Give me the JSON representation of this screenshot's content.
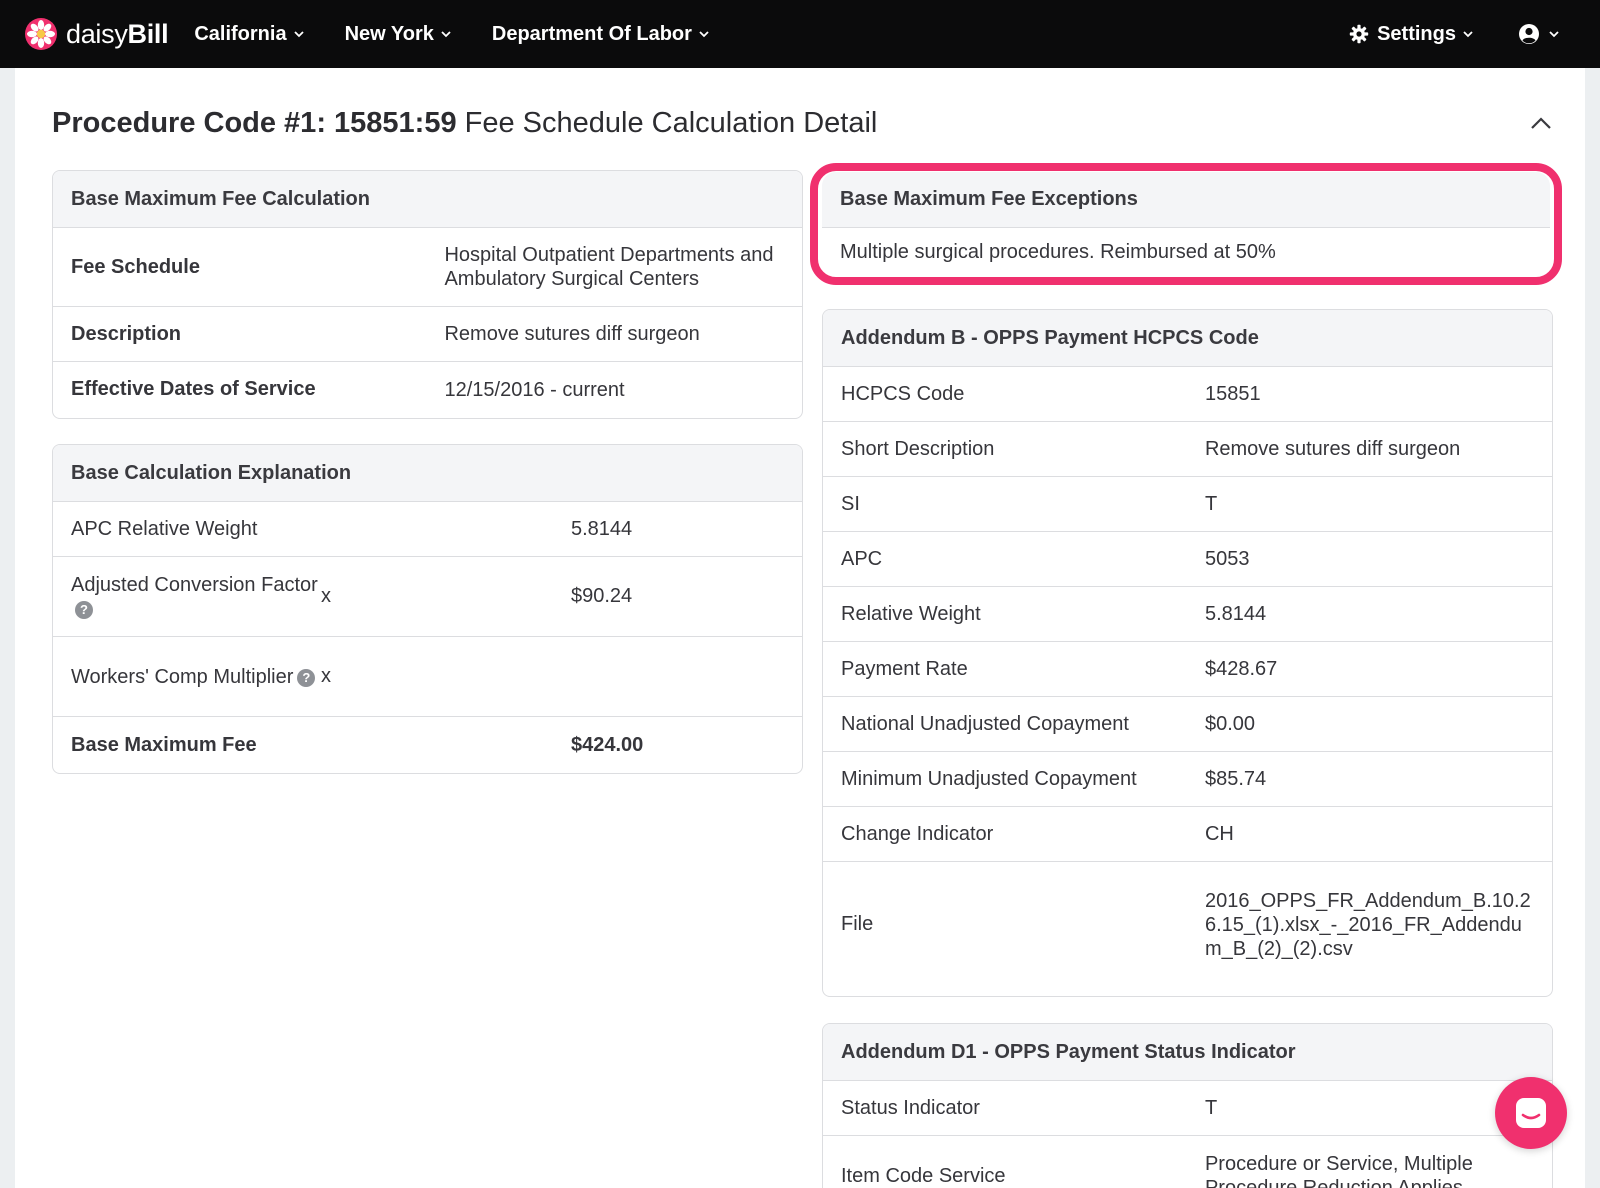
{
  "nav": {
    "logo_light": "daisy",
    "logo_bold": "Bill",
    "items": [
      "California",
      "New York",
      "Department Of Labor"
    ],
    "settings_label": "Settings"
  },
  "page": {
    "title_bold": "Procedure Code #1: 15851:59",
    "title_rest": " Fee Schedule Calculation Detail"
  },
  "base_max_fee": {
    "heading": "Base Maximum Fee Calculation",
    "rows": [
      {
        "label": "Fee Schedule",
        "value": "Hospital Outpatient Departments and Ambulatory Surgical Centers"
      },
      {
        "label": "Description",
        "value": "Remove sutures diff surgeon"
      },
      {
        "label": "Effective Dates of Service",
        "value": "12/15/2016 - current"
      }
    ]
  },
  "base_calc": {
    "heading": "Base Calculation Explanation",
    "rows": [
      {
        "label": "APC Relative Weight",
        "op": "",
        "value": "5.8144"
      },
      {
        "label": "Adjusted Conversion Factor",
        "op": "x",
        "value": "$90.24"
      },
      {
        "label": "Workers' Comp Multiplier",
        "op": "x",
        "value": ""
      },
      {
        "label": "Base Maximum Fee",
        "op": "",
        "value": "$424.00"
      }
    ]
  },
  "exceptions": {
    "heading": "Base Maximum Fee Exceptions",
    "text": "Multiple surgical procedures. Reimbursed at 50%"
  },
  "addendum_b": {
    "heading": "Addendum B - OPPS Payment HCPCS Code",
    "rows": [
      {
        "label": "HCPCS Code",
        "value": "15851"
      },
      {
        "label": "Short Description",
        "value": "Remove sutures diff surgeon"
      },
      {
        "label": "SI",
        "value": "T"
      },
      {
        "label": "APC",
        "value": "5053"
      },
      {
        "label": "Relative Weight",
        "value": "5.8144"
      },
      {
        "label": "Payment Rate",
        "value": "$428.67"
      },
      {
        "label": "National Unadjusted Copayment",
        "value": "$0.00"
      },
      {
        "label": "Minimum Unadjusted Copayment",
        "value": "$85.74"
      },
      {
        "label": "Change Indicator",
        "value": "CH"
      },
      {
        "label": "File",
        "value": "2016_OPPS_FR_Addendum_B.10.26.15_(1).xlsx_-_2016_FR_Addendum_B_(2)_(2).csv"
      }
    ]
  },
  "addendum_d1": {
    "heading": "Addendum D1 - OPPS Payment Status Indicator",
    "rows": [
      {
        "label": "Status Indicator",
        "value": "T"
      },
      {
        "label": "Item Code Service",
        "value": "Procedure or Service, Multiple Procedure Reduction Applies"
      }
    ]
  },
  "colors": {
    "nav_bg": "#0b0b0c",
    "accent": "#f0306e",
    "card_header_bg": "#f4f5f7"
  },
  "icons": {
    "logo": "daisy-flower-icon",
    "settings": "gear-icon",
    "user": "user-circle-icon",
    "collapse": "chevron-up-icon",
    "chat": "chat-bubble-icon"
  }
}
